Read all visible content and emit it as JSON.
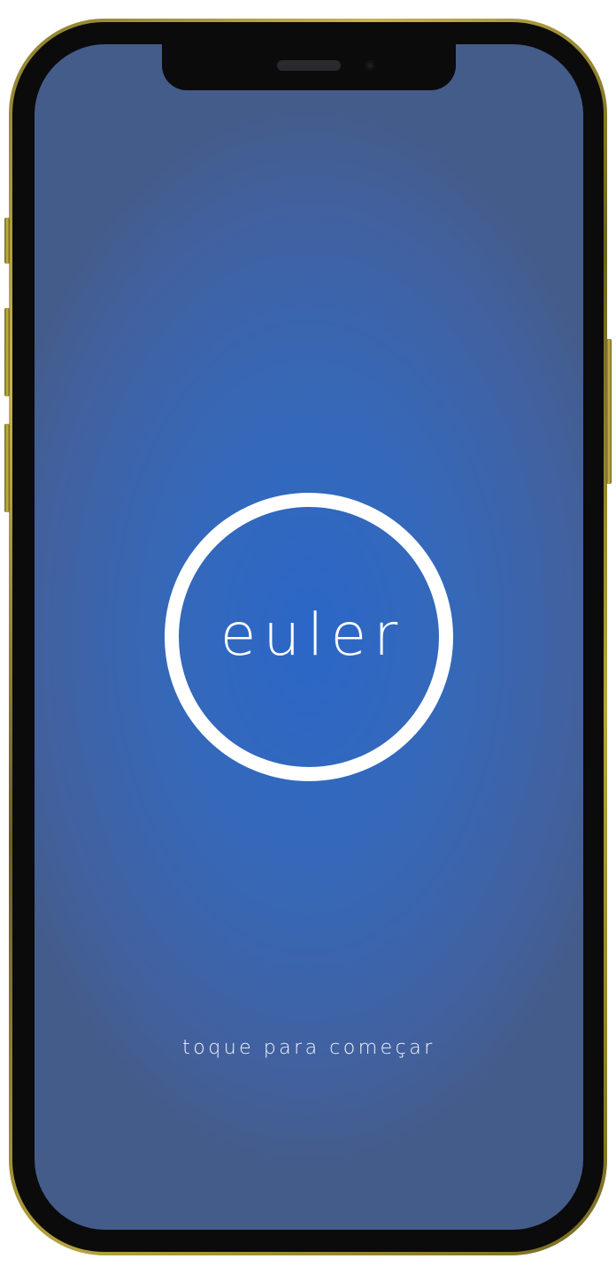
{
  "app": {
    "logo_text": "euler",
    "tap_hint": "toque para começar"
  },
  "colors": {
    "screen_center": "#2b67c8",
    "screen_edge": "#445c8a",
    "logo": "#ffffff",
    "frame_gold": "#b7a33d"
  },
  "icons": {
    "logo": "circle-logo-icon"
  }
}
